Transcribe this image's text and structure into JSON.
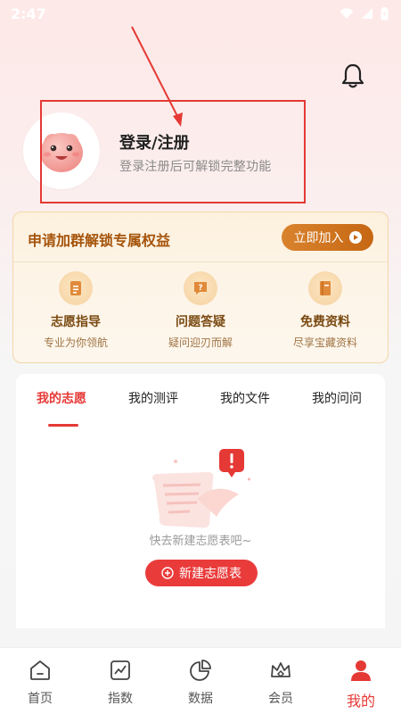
{
  "status_bar": {
    "time": "2:47"
  },
  "profile": {
    "title": "登录/注册",
    "subtitle": "登录注册后可解锁完整功能"
  },
  "group_card": {
    "title": "申请加群解锁专属权益",
    "join_label": "立即加入",
    "benefits": [
      {
        "title": "志愿指导",
        "subtitle": "专业为你领航",
        "icon": "document-icon"
      },
      {
        "title": "问题答疑",
        "subtitle": "疑问迎刃而解",
        "icon": "question-chat-icon"
      },
      {
        "title": "免费资料",
        "subtitle": "尽享宝藏资料",
        "icon": "book-icon"
      }
    ]
  },
  "tabs": [
    {
      "label": "我的志愿",
      "active": true
    },
    {
      "label": "我的测评",
      "active": false
    },
    {
      "label": "我的文件",
      "active": false
    },
    {
      "label": "我的问问",
      "active": false
    }
  ],
  "empty_state": {
    "text": "快去新建志愿表吧~",
    "button_label": "新建志愿表"
  },
  "tabbar": [
    {
      "label": "首页",
      "icon": "home-icon",
      "active": false
    },
    {
      "label": "指数",
      "icon": "chart-icon",
      "active": false
    },
    {
      "label": "数据",
      "icon": "pie-icon",
      "active": false
    },
    {
      "label": "会员",
      "icon": "crown-icon",
      "active": false
    },
    {
      "label": "我的",
      "icon": "person-icon",
      "active": true
    }
  ],
  "colors": {
    "accent": "#e53935",
    "gold": "#c66713",
    "annotation": "#e53935"
  }
}
